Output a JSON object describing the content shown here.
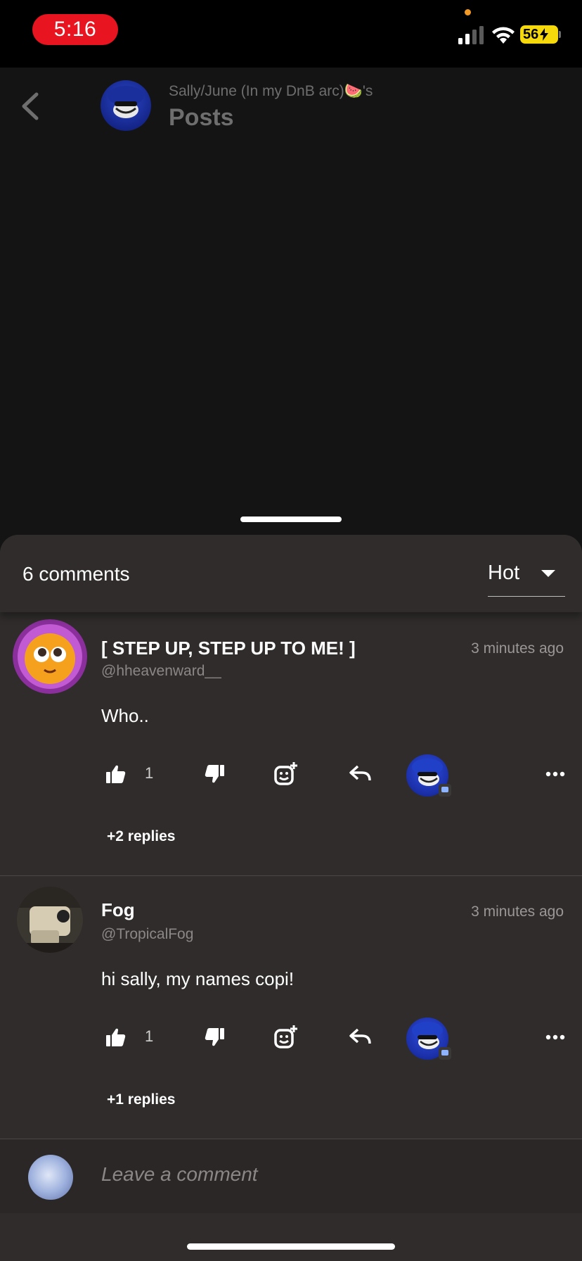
{
  "status_bar": {
    "time": "5:16",
    "battery": "56"
  },
  "background_page": {
    "subtitle": "Sally/June (In my DnB arc)🍉's",
    "title": "Posts"
  },
  "sheet": {
    "comment_count": "6 comments",
    "sort": {
      "selected": "Hot"
    }
  },
  "comments": [
    {
      "name": "[ STEP UP, STEP UP TO ME! ]",
      "handle": "@hheavenward__",
      "time": "3 minutes ago",
      "text": "Who..",
      "likes": "1",
      "replies": "+2 replies"
    },
    {
      "name": "Fog",
      "handle": "@TropicalFog",
      "time": "3 minutes ago",
      "text": "hi sally, my names copi!",
      "likes": "1",
      "replies": "+1 replies"
    }
  ],
  "composer": {
    "placeholder": "Leave a comment"
  },
  "colors": {
    "time_pill": "#e8141f",
    "battery": "#f5d90a",
    "sheet_bg": "#2f2c2b",
    "page_bg": "#141414"
  }
}
